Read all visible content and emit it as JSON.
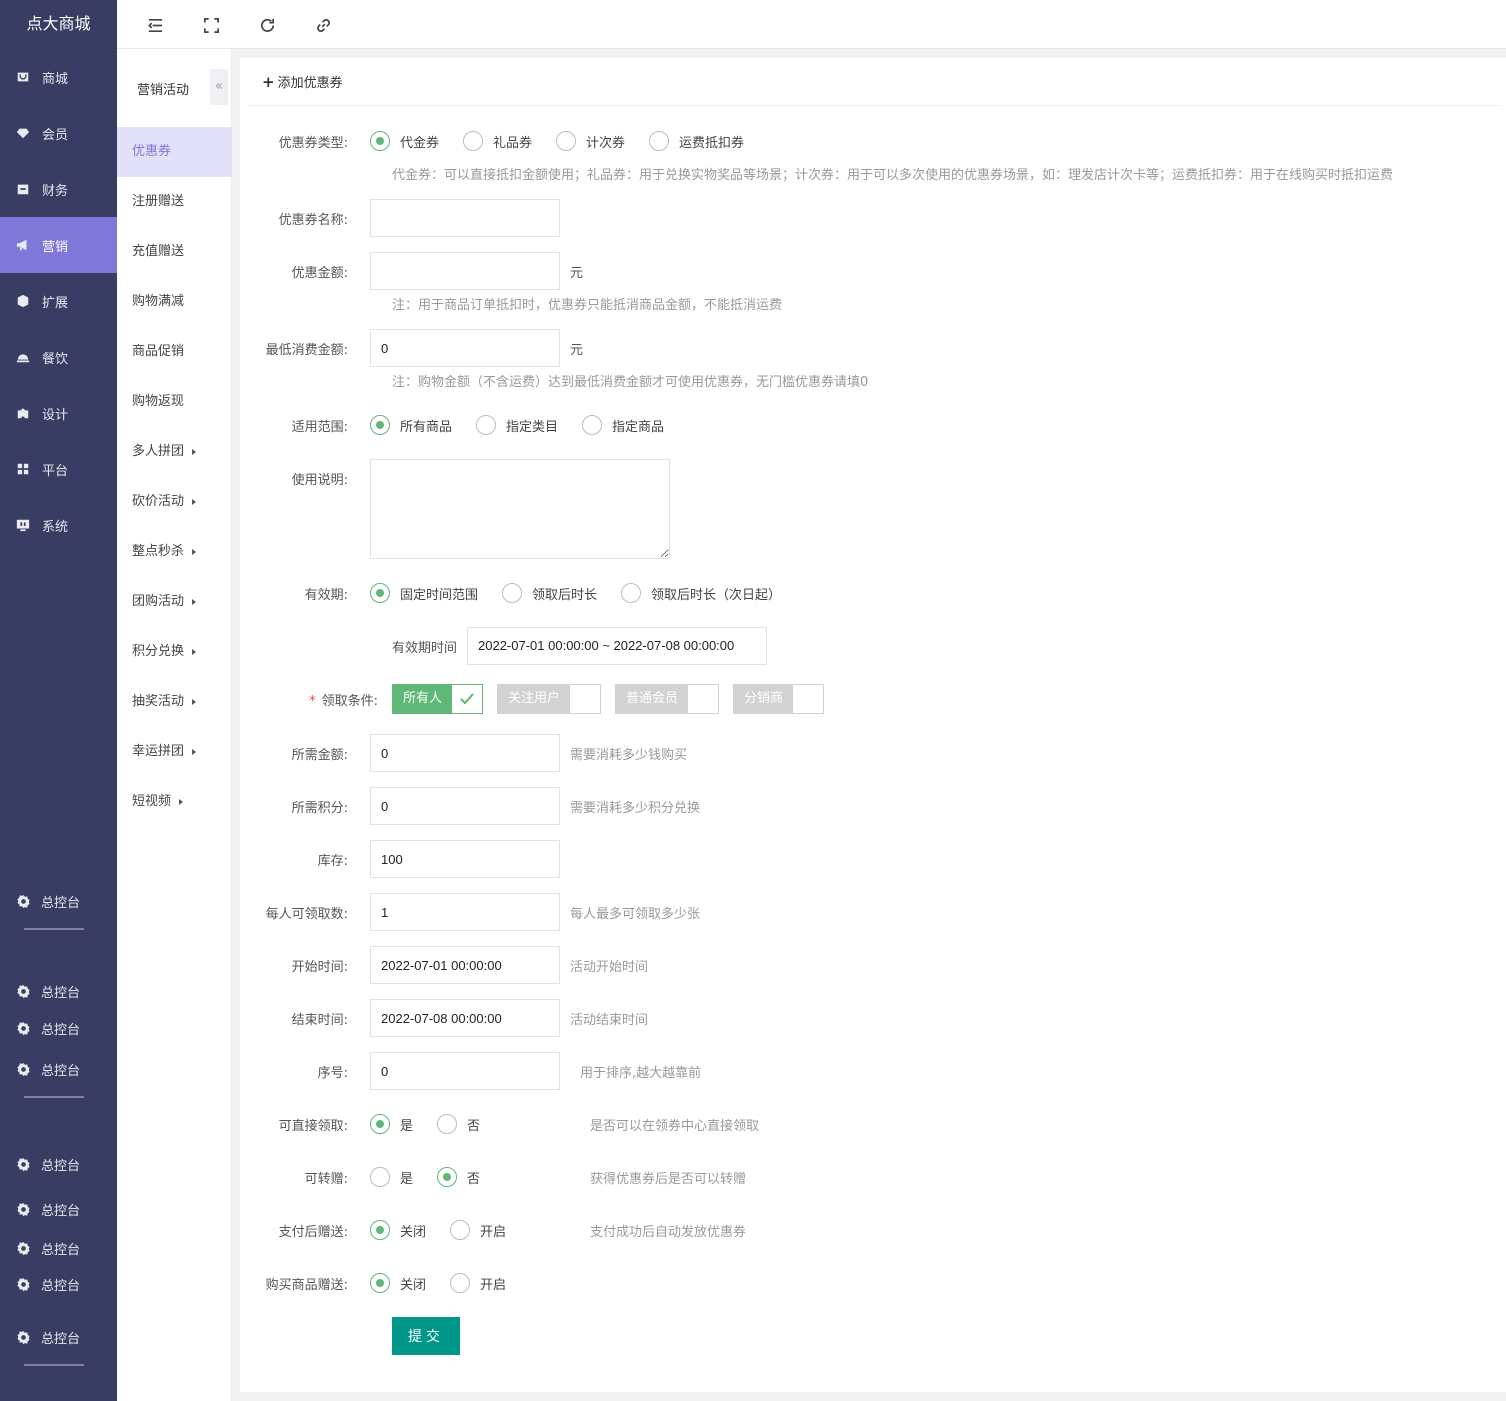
{
  "app": {
    "title": "点大商城"
  },
  "sidebar": {
    "items": [
      {
        "label": "商城",
        "icon": "shop-icon",
        "active": false
      },
      {
        "label": "会员",
        "icon": "diamond-icon",
        "active": false
      },
      {
        "label": "财务",
        "icon": "wallet-icon",
        "active": false
      },
      {
        "label": "营销",
        "icon": "megaphone-icon",
        "active": true
      },
      {
        "label": "扩展",
        "icon": "cube-icon",
        "active": false
      },
      {
        "label": "餐饮",
        "icon": "cloche-icon",
        "active": false
      },
      {
        "label": "设计",
        "icon": "puzzle-icon",
        "active": false
      },
      {
        "label": "平台",
        "icon": "grid-icon",
        "active": false
      },
      {
        "label": "系统",
        "icon": "monitor-icon",
        "active": false
      }
    ],
    "console_label": "总控台"
  },
  "topbar": {
    "icons": [
      "menu-fold-icon",
      "fullscreen-icon",
      "refresh-icon",
      "link-icon"
    ]
  },
  "subnav": {
    "title": "营销活动",
    "collapse_glyph": "«",
    "items": [
      {
        "label": "优惠券",
        "active": true,
        "arrow": false
      },
      {
        "label": "注册赠送",
        "arrow": false
      },
      {
        "label": "充值赠送",
        "arrow": false
      },
      {
        "label": "购物满减",
        "arrow": false
      },
      {
        "label": "商品促销",
        "arrow": false
      },
      {
        "label": "购物返现",
        "arrow": false
      },
      {
        "label": "多人拼团",
        "arrow": true
      },
      {
        "label": "砍价活动",
        "arrow": true
      },
      {
        "label": "整点秒杀",
        "arrow": true
      },
      {
        "label": "团购活动",
        "arrow": true
      },
      {
        "label": "积分兑换",
        "arrow": true
      },
      {
        "label": "抽奖活动",
        "arrow": true
      },
      {
        "label": "幸运拼团",
        "arrow": true
      },
      {
        "label": "短视频",
        "arrow": true
      }
    ]
  },
  "form": {
    "header": "添加优惠券",
    "coupon_type": {
      "label": "优惠券类型:",
      "options": [
        "代金券",
        "礼品券",
        "计次券",
        "运费抵扣券"
      ],
      "selected": 0,
      "hint": "代金券：可以直接抵扣金额使用；礼品券：用于兑换实物奖品等场景；计次券：用于可以多次使用的优惠券场景，如：理发店计次卡等；运费抵扣券：用于在线购买时抵扣运费"
    },
    "name": {
      "label": "优惠券名称:",
      "value": ""
    },
    "amount": {
      "label": "优惠金额:",
      "value": "",
      "unit": "元",
      "hint": "注：用于商品订单抵扣时，优惠券只能抵消商品金额，不能抵消运费"
    },
    "min_spend": {
      "label": "最低消费金额:",
      "value": "0",
      "unit": "元",
      "hint": "注：购物金额（不含运费）达到最低消费金额才可使用优惠券，无门槛优惠券请填0"
    },
    "scope": {
      "label": "适用范围:",
      "options": [
        "所有商品",
        "指定类目",
        "指定商品"
      ],
      "selected": 0
    },
    "description": {
      "label": "使用说明:",
      "value": ""
    },
    "validity": {
      "label": "有效期:",
      "options": [
        "固定时间范围",
        "领取后时长",
        "领取后时长（次日起）"
      ],
      "selected": 0,
      "range_label": "有效期时间",
      "range_value": "2022-07-01 00:00:00 ~ 2022-07-08 00:00:00"
    },
    "condition": {
      "required_mark": "*",
      "label": "领取条件:",
      "options": [
        {
          "label": "所有人",
          "checked": true
        },
        {
          "label": "关注用户",
          "checked": false
        },
        {
          "label": "普通会员",
          "checked": false
        },
        {
          "label": "分销商",
          "checked": false
        }
      ]
    },
    "price": {
      "label": "所需金额:",
      "value": "0",
      "aside": "需要消耗多少钱购买"
    },
    "points": {
      "label": "所需积分:",
      "value": "0",
      "aside": "需要消耗多少积分兑换"
    },
    "stock": {
      "label": "库存:",
      "value": "100"
    },
    "per_user": {
      "label": "每人可领取数:",
      "value": "1",
      "aside": "每人最多可领取多少张"
    },
    "start_time": {
      "label": "开始时间:",
      "value": "2022-07-01 00:00:00",
      "aside": "活动开始时间"
    },
    "end_time": {
      "label": "结束时间:",
      "value": "2022-07-08 00:00:00",
      "aside": "活动结束时间"
    },
    "sort": {
      "label": "序号:",
      "value": "0",
      "aside": "用于排序,越大越靠前"
    },
    "direct_claim": {
      "label": "可直接领取:",
      "options": [
        "是",
        "否"
      ],
      "selected": 0,
      "aside": "是否可以在领券中心直接领取"
    },
    "transferable": {
      "label": "可转赠:",
      "options": [
        "是",
        "否"
      ],
      "selected": 1,
      "aside": "获得优惠券后是否可以转赠"
    },
    "gift_after_pay": {
      "label": "支付后赠送:",
      "options": [
        "关闭",
        "开启"
      ],
      "selected": 0,
      "aside": "支付成功后自动发放优惠券"
    },
    "gift_on_purchase": {
      "label": "购买商品赠送:",
      "options": [
        "关闭",
        "开启"
      ],
      "selected": 0
    },
    "submit_label": "提交"
  },
  "colors": {
    "sidebar_bg": "#393d63",
    "sidebar_active": "#7f78d9",
    "green": "#5fb878",
    "submit": "#009688"
  }
}
